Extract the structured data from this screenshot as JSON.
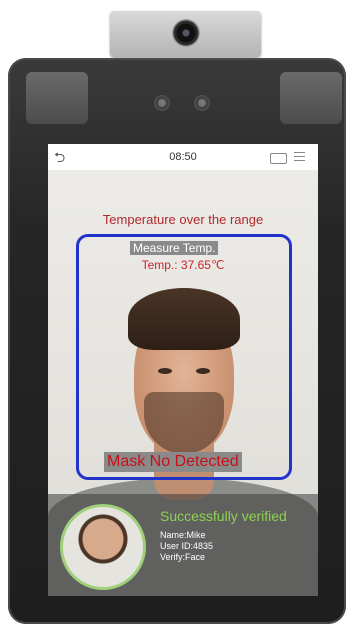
{
  "screen": {
    "time": "08:50",
    "warning": "Temperature over the range",
    "measure_label": "Measure Temp.",
    "temperature": "Temp.: 37.65℃",
    "mask_status": "Mask No Detected",
    "verification": {
      "title": "Successfully verified",
      "name": "Name:Mike",
      "user_id": "User ID:4835",
      "verify": "Verify:Face"
    }
  },
  "colors": {
    "warning_text": "#b3282a",
    "face_frame": "#2233cc",
    "verified_text": "#8fd14f"
  },
  "icons": [
    "back-icon",
    "keyboard-icon",
    "menu-icon"
  ]
}
